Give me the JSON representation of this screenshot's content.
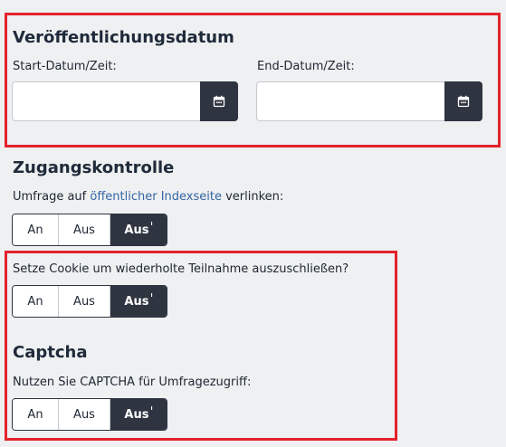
{
  "publication": {
    "title": "Veröffentlichungsdatum",
    "start_label": "Start-Datum/Zeit:",
    "start_value": "",
    "end_label": "End-Datum/Zeit:",
    "end_value": ""
  },
  "access": {
    "title": "Zugangskontrolle",
    "public_index_prefix": "Umfrage auf ",
    "public_index_link": "öffentlicher Indexseite",
    "public_index_suffix": " verlinken:",
    "public_index_toggle": {
      "on": "An",
      "off": "Aus",
      "inherit": "Aus",
      "inherit_marker": "ᴵ",
      "selected": "inherit"
    },
    "cookie_label": "Setze Cookie um wiederholte Teilnahme auszuschließen?",
    "cookie_toggle": {
      "on": "An",
      "off": "Aus",
      "inherit": "Aus",
      "inherit_marker": "ᴵ",
      "selected": "inherit"
    }
  },
  "captcha": {
    "title": "Captcha",
    "label": "Nutzen Sie CAPTCHA für Umfragezugriff:",
    "toggle": {
      "on": "An",
      "off": "Aus",
      "inherit": "Aus",
      "inherit_marker": "ᴵ",
      "selected": "inherit"
    }
  },
  "icons": {
    "calendar": "calendar-icon"
  },
  "colors": {
    "highlight": "#e3232c",
    "button_dark": "#2e3440",
    "link": "#3465a4",
    "background": "#eef0f1"
  }
}
